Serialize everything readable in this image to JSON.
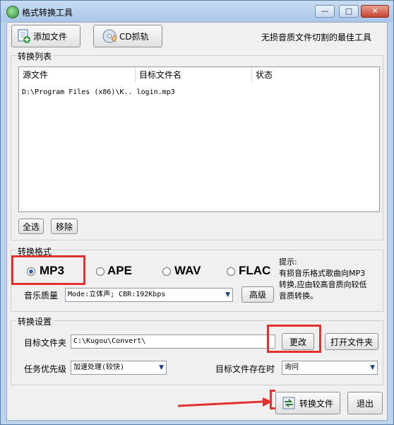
{
  "window": {
    "title": "格式转换工具",
    "minimize": "—",
    "maximize": "□",
    "close": "✕"
  },
  "toolbar": {
    "add_file": "添加文件",
    "cd_rip": "CD抓轨",
    "slogan": "无损音质文件切割的最佳工具"
  },
  "convert_list": {
    "label": "转换列表",
    "columns": [
      "源文件",
      "目标文件名",
      "状态"
    ],
    "rows": [
      {
        "source": "D:\\Program Files (x86)\\K..",
        "target": "login.mp3",
        "status": ""
      }
    ],
    "select_all": "全选",
    "remove": "移除"
  },
  "format": {
    "label": "转换格式",
    "options": [
      "MP3",
      "APE",
      "WAV",
      "FLAC"
    ],
    "selected": "MP3",
    "quality_label": "音乐质量",
    "quality_value": "Mode:立体声; CBR:192Kbps",
    "advanced": "高级",
    "tip": "提示:\n  有损音乐格式歌曲向MP3\n转换,应由较高音质向较低\n音质转换。"
  },
  "settings": {
    "label": "转换设置",
    "target_folder_label": "目标文件夹",
    "target_folder_value": "C:\\Kugou\\Convert\\",
    "change": "更改",
    "open_folder": "打开文件夹",
    "priority_label": "任务优先级",
    "priority_value": "加速处理(较快)",
    "exists_label": "目标文件存在时",
    "exists_value": "询问"
  },
  "actions": {
    "convert": "转换文件",
    "exit": "退出"
  },
  "colors": {
    "highlight": "#e0322f",
    "radio": "#2f66c4"
  }
}
